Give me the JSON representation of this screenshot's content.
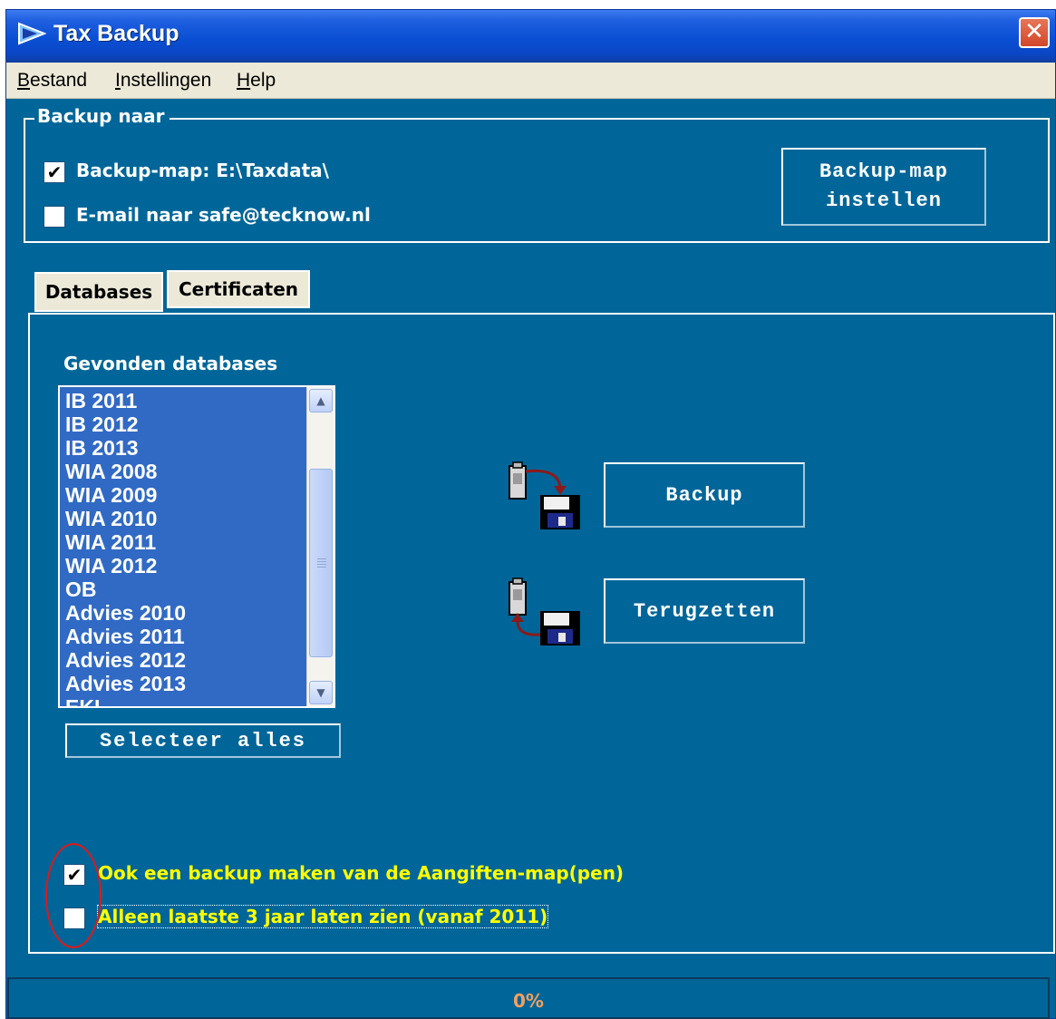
{
  "window": {
    "title": "Tax Backup",
    "close_glyph": "✕"
  },
  "menu": [
    {
      "ul": "B",
      "rest": "estand"
    },
    {
      "ul": "I",
      "rest": "nstellingen"
    },
    {
      "ul": "H",
      "rest": "elp"
    }
  ],
  "backup_group": {
    "title": "Backup naar",
    "backup_map": {
      "checked": true,
      "label": "Backup-map: E:\\Taxdata\\"
    },
    "email": {
      "checked": false,
      "label": "E-mail naar safe@tecknow.nl"
    },
    "set_map_button": {
      "line1": "Backup-map",
      "line2": "instellen"
    }
  },
  "tabs": [
    {
      "label": "Databases",
      "active": true
    },
    {
      "label": "Certificaten",
      "active": false
    }
  ],
  "databases": {
    "heading": "Gevonden databases",
    "items": [
      "IB 2011",
      "IB 2012",
      "IB 2013",
      "WIA 2008",
      "WIA 2009",
      "WIA 2010",
      "WIA 2011",
      "WIA 2012",
      "OB",
      "Advies 2010",
      "Advies 2011",
      "Advies 2012",
      "Advies 2013",
      "EKI"
    ],
    "select_all_label": "Selecteer alles"
  },
  "actions": {
    "backup_label": "Backup",
    "restore_label": "Terugzetten"
  },
  "options": {
    "aangiften": {
      "checked": true,
      "label": "Ook een backup maken van de Aangiften-map(pen)"
    },
    "laatste3": {
      "checked": false,
      "label": "Alleen laatste 3 jaar laten zien (vanaf 2011)"
    }
  },
  "progress": {
    "text": "0%",
    "value": 0
  },
  "colors": {
    "window_bg": "#006699",
    "selection": "#316ac5",
    "option_text": "#ffff00",
    "annotation": "#e01818"
  }
}
